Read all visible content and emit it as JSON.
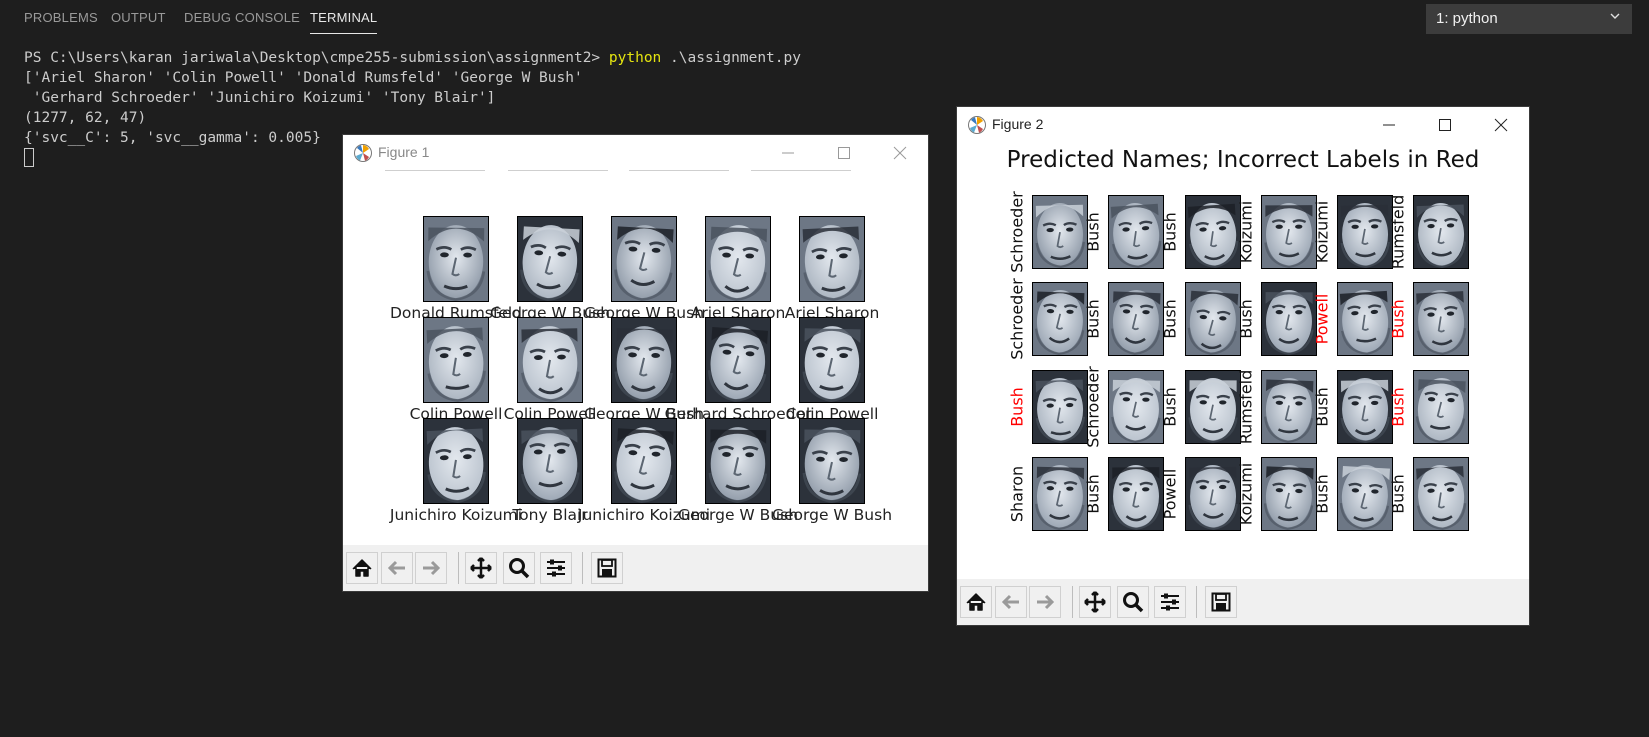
{
  "panel": {
    "tabs": [
      "PROBLEMS",
      "OUTPUT",
      "DEBUG CONSOLE",
      "TERMINAL"
    ],
    "terminal_select": {
      "value": "1: python",
      "icon": "chevron-down-icon"
    }
  },
  "terminal": {
    "prompt": "PS C:\\Users\\karan jariwala\\Desktop\\cmpe255-submission\\assignment2> ",
    "command": "python",
    "command_arg": " .\\assignment.py",
    "output": [
      "['Ariel Sharon' 'Colin Powell' 'Donald Rumsfeld' 'George W Bush'",
      " 'Gerhard Schroeder' 'Junichiro Koizumi' 'Tony Blair']",
      "(1277, 62, 47)",
      "{'svc__C': 5, 'svc__gamma': 0.005}"
    ]
  },
  "figure1": {
    "title": "Figure 1",
    "labels": [
      "Donald Rumsfeld",
      "George W Bush",
      "George W Bush",
      "Ariel Sharon",
      "Ariel Sharon",
      "Colin Powell",
      "Colin Powell",
      "George W Bush",
      "Gerhard Schroeder",
      "Colin Powell",
      "Junichiro Koizumi",
      "Tony Blair",
      "Junichiro Koizumi",
      "George W Bush",
      "George W Bush"
    ]
  },
  "figure2": {
    "title": "Figure 2",
    "plot_title": "Predicted Names; Incorrect Labels in Red",
    "error_color": "#ff0000",
    "ok_color": "#111111",
    "predictions": [
      {
        "label": "Schroeder",
        "correct": true
      },
      {
        "label": "Bush",
        "correct": true
      },
      {
        "label": "Bush",
        "correct": true
      },
      {
        "label": "Koizumi",
        "correct": true
      },
      {
        "label": "Koizumi",
        "correct": true
      },
      {
        "label": "Rumsfeld",
        "correct": true
      },
      {
        "label": "Schroeder",
        "correct": true
      },
      {
        "label": "Bush",
        "correct": true
      },
      {
        "label": "Bush",
        "correct": true
      },
      {
        "label": "Bush",
        "correct": true
      },
      {
        "label": "Powell",
        "correct": false
      },
      {
        "label": "Bush",
        "correct": false
      },
      {
        "label": "Bush",
        "correct": false
      },
      {
        "label": "Schroeder",
        "correct": true
      },
      {
        "label": "Bush",
        "correct": true
      },
      {
        "label": "Rumsfeld",
        "correct": true
      },
      {
        "label": "Bush",
        "correct": true
      },
      {
        "label": "Bush",
        "correct": false
      },
      {
        "label": "Sharon",
        "correct": true
      },
      {
        "label": "Bush",
        "correct": true
      },
      {
        "label": "Powell",
        "correct": true
      },
      {
        "label": "Koizumi",
        "correct": true
      },
      {
        "label": "Bush",
        "correct": true
      },
      {
        "label": "Bush",
        "correct": true
      }
    ]
  },
  "toolbar_icons": [
    "home-icon",
    "back-arrow-icon",
    "forward-arrow-icon",
    "pan-icon",
    "zoom-icon",
    "configure-subplots-icon",
    "save-icon"
  ],
  "colors": {
    "terminal_bg": "#1e1e1e",
    "command": "#e5e510",
    "figure_bg": "#ffffff",
    "toolbar_bg": "#f0f0f0"
  }
}
